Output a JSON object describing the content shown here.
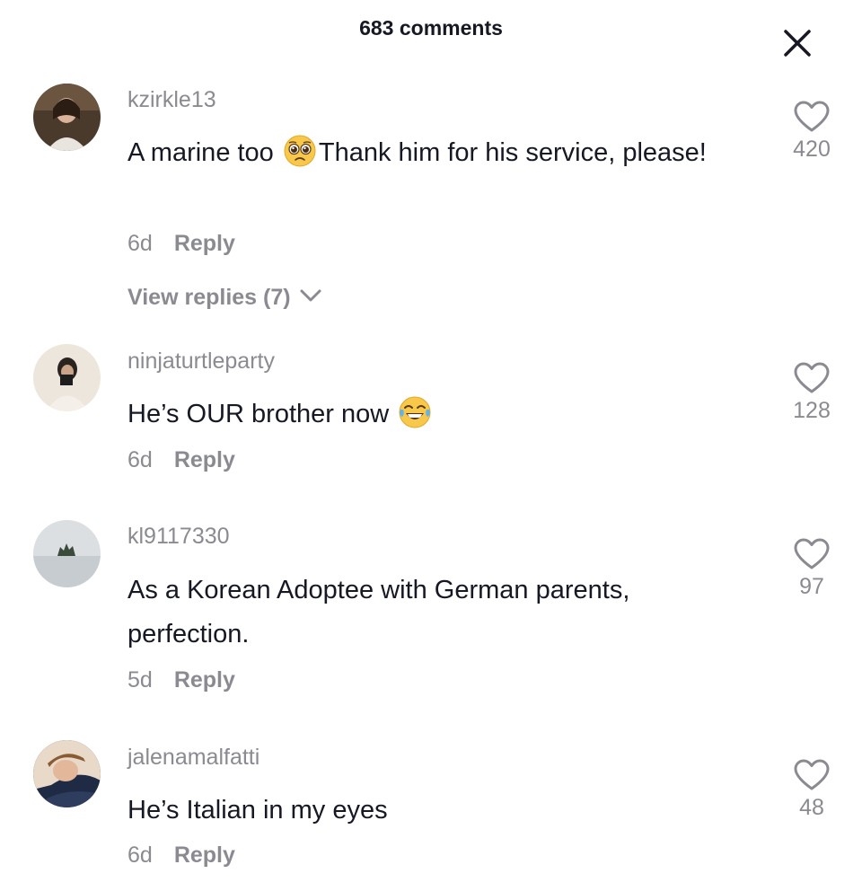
{
  "header": {
    "title": "683 comments",
    "close_icon": "close-icon"
  },
  "comments": [
    {
      "username": "kzirkle13",
      "text_before": "A marine too ",
      "emoji": "pleading-face-emoji",
      "text_after": "Thank him for his service, please!",
      "time": "6d",
      "reply_label": "Reply",
      "likes": "420",
      "view_replies": "View replies (7)"
    },
    {
      "username": "ninjaturtleparty",
      "text_before": "He’s OUR brother now ",
      "emoji": "tears-of-joy-emoji",
      "text_after": "",
      "time": "6d",
      "reply_label": "Reply",
      "likes": "128"
    },
    {
      "username": "kl9117330",
      "text_before": "As a Korean Adoptee with German parents, perfection.",
      "time": "5d",
      "reply_label": "Reply",
      "likes": "97"
    },
    {
      "username": "jalenamalfatti",
      "text_before": "He’s Italian in my eyes",
      "time": "6d",
      "reply_label": "Reply",
      "likes": "48"
    }
  ],
  "colors": {
    "text_primary": "#161823",
    "text_secondary": "#8a8b91",
    "background": "#ffffff"
  }
}
